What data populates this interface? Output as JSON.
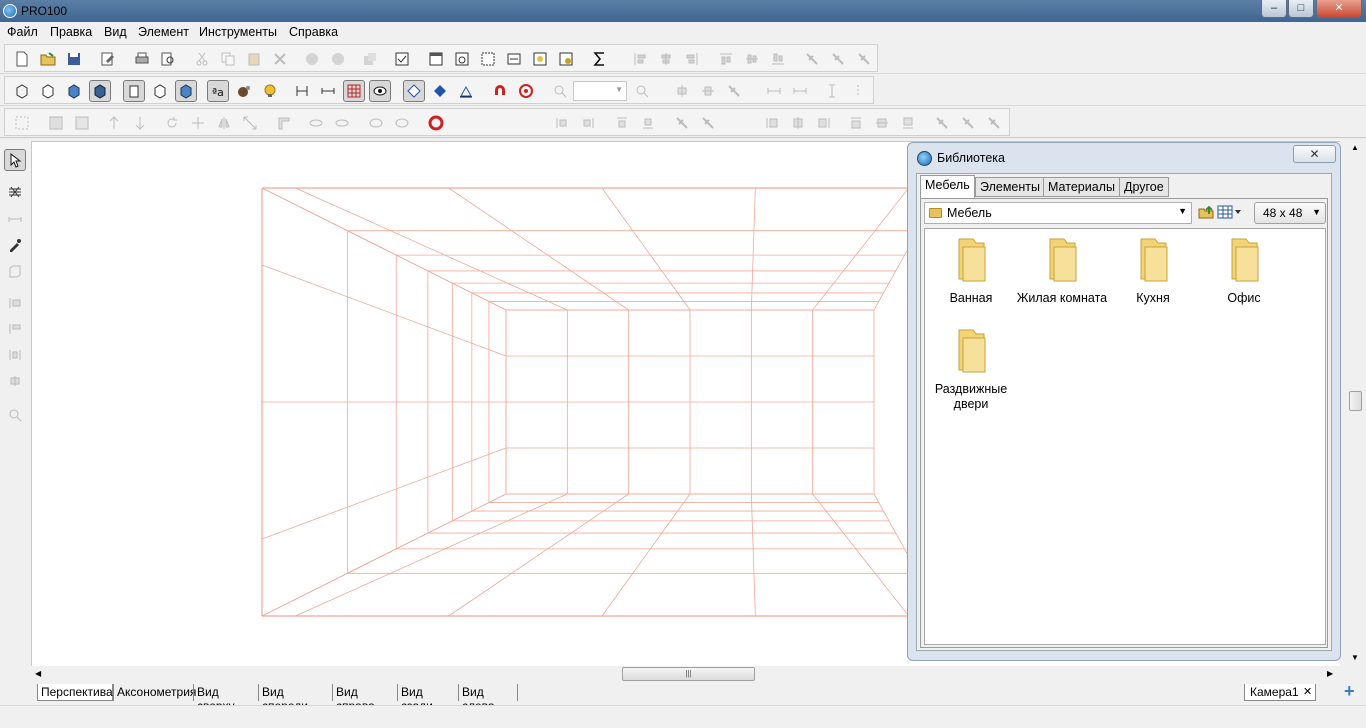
{
  "app": {
    "title": "PRO100"
  },
  "window_controls": {
    "minimize": "–",
    "maximize": "□",
    "close": "✕"
  },
  "menu": [
    "Файл",
    "Правка",
    "Вид",
    "Элемент",
    "Инструменты",
    "Справка"
  ],
  "library": {
    "title": "Библиотека",
    "close_label": "✕",
    "tabs": [
      "Мебель",
      "Элементы",
      "Материалы",
      "Другое"
    ],
    "active_tab": "Мебель",
    "folder_combo": "Мебель",
    "icon_size": "48 x  48",
    "items": [
      {
        "label": "Ванная",
        "icon": "folder-icon"
      },
      {
        "label": "Жилая комната",
        "icon": "folder-icon"
      },
      {
        "label": "Кухня",
        "icon": "folder-icon"
      },
      {
        "label": "Офис",
        "icon": "folder-icon"
      },
      {
        "label": "Раздвижные двери",
        "icon": "folder-icon"
      }
    ]
  },
  "view_tabs": [
    "Перспектива",
    "Аксонометрия",
    "Вид сверху",
    "Вид спереди",
    "Вид справа",
    "Вид сзади",
    "Вид слева"
  ],
  "active_view_tab": "Перспектива",
  "camera": {
    "label": "Камера1",
    "close": "✕",
    "add": "+"
  },
  "scrollbar_grip": "|||",
  "grid_color": "#f0a898"
}
